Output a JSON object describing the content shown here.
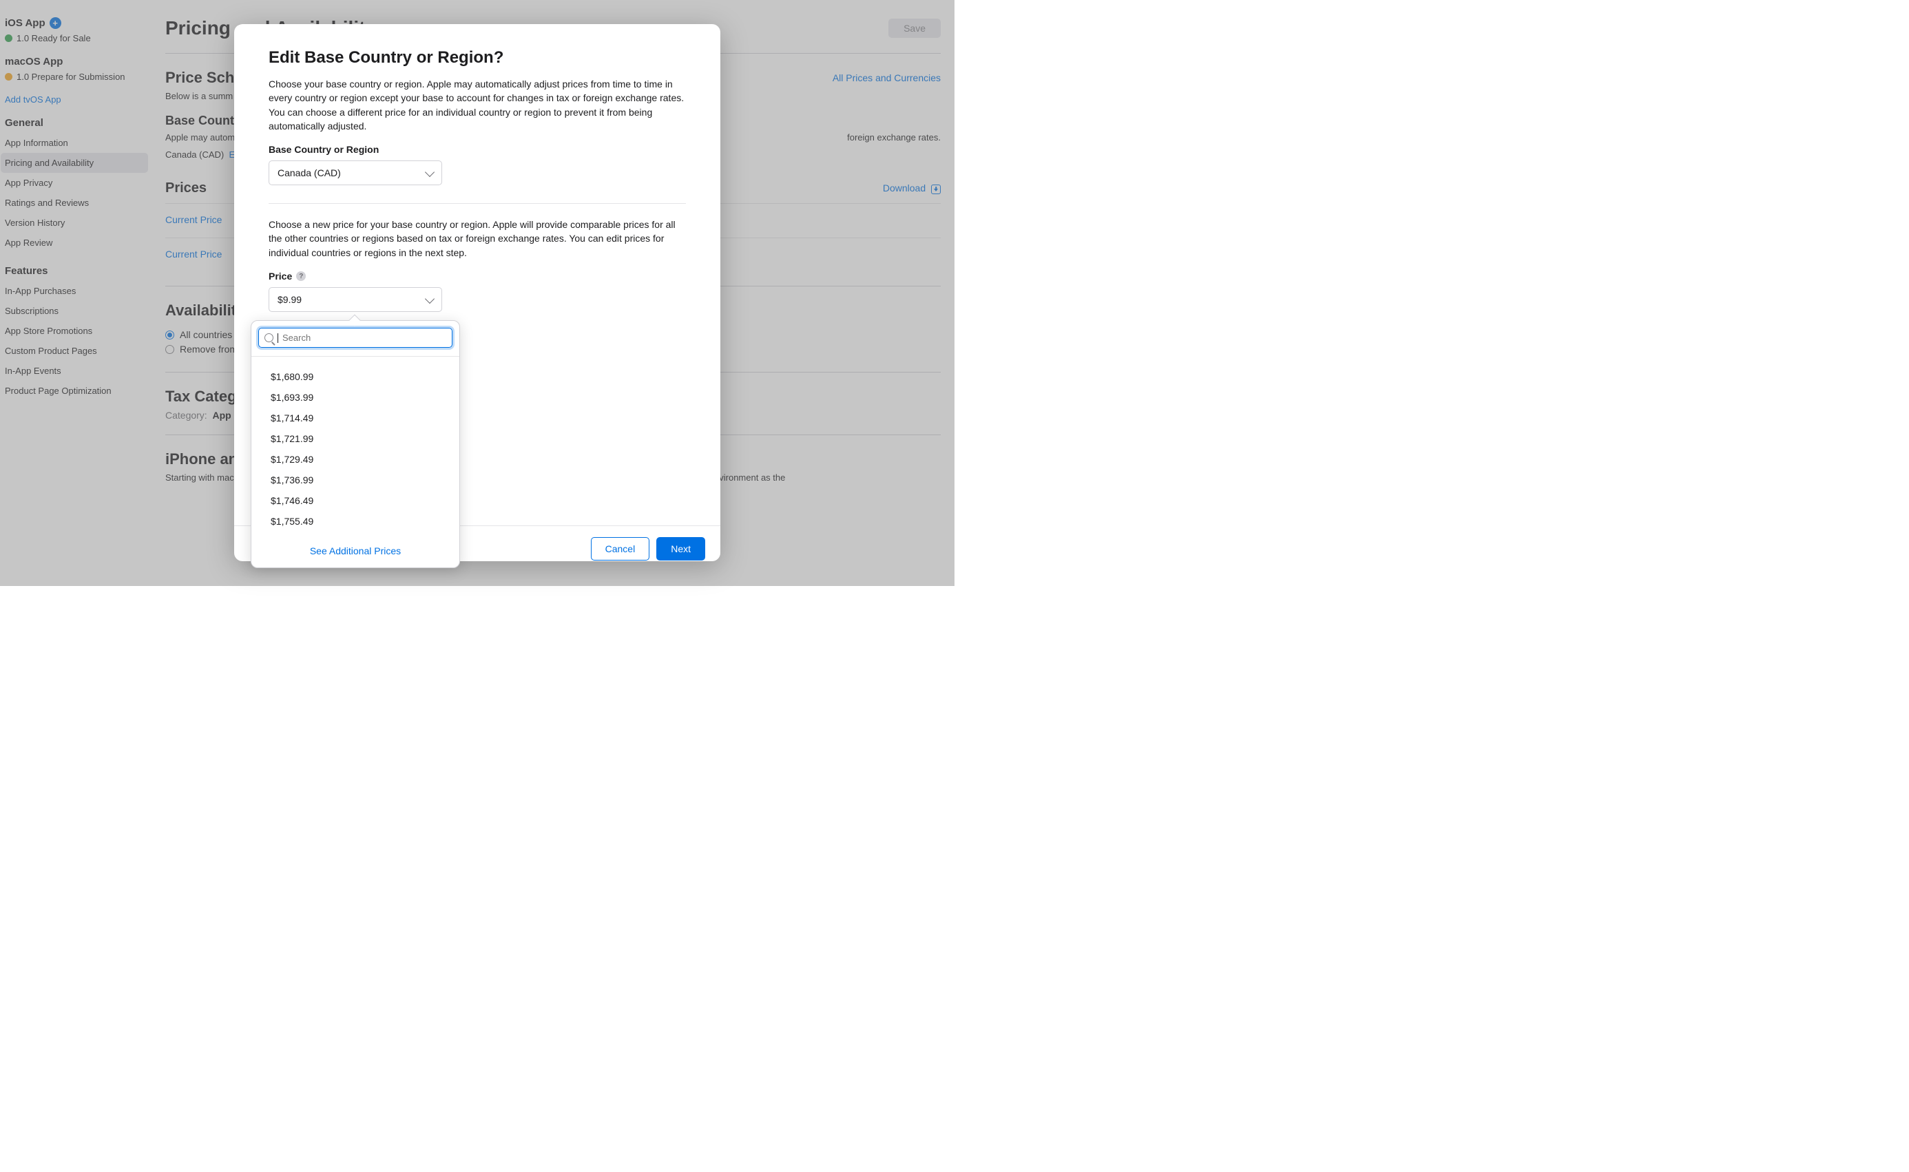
{
  "sidebar": {
    "platforms": [
      {
        "title": "iOS App",
        "status": "1.0 Ready for Sale",
        "dot": "green",
        "has_add": true
      },
      {
        "title": "macOS App",
        "status": "1.0 Prepare for Submission",
        "dot": "yellow",
        "has_add": false
      }
    ],
    "add_tvos": "Add tvOS App",
    "general_title": "General",
    "general_items": [
      "App Information",
      "Pricing and Availability",
      "App Privacy",
      "Ratings and Reviews",
      "Version History",
      "App Review"
    ],
    "active_index": 1,
    "features_title": "Features",
    "features_items": [
      "In-App Purchases",
      "Subscriptions",
      "App Store Promotions",
      "Custom Product Pages",
      "In-App Events",
      "Product Page Optimization"
    ]
  },
  "page": {
    "title": "Pricing and Availability",
    "save": "Save",
    "schedule_title": "Price Schedule",
    "schedule_desc": "Below is a summ",
    "schedule_link": "All Prices and Currencies",
    "base_title": "Base Country or Region",
    "base_desc_a": "Apple may autom",
    "base_desc_b": "foreign exchange rates.",
    "base_value": "Canada (CAD)",
    "base_edit": "E",
    "prices_title": "Prices",
    "download": "Download",
    "current_price": "Current Price",
    "availability_title": "Availability",
    "avail_opt1": "All countries",
    "avail_opt2": "Remove from",
    "tax_title": "Tax Category",
    "tax_label": "Category:",
    "tax_value": "App S",
    "iphone_title": "iPhone and",
    "iphone_desc_a": "Starting with macO",
    "iphone_desc_b": "e made available on Apple silicon Macs. Apps will run natively and use the same frameworks, resources, and runtime environment as the"
  },
  "modal": {
    "title": "Edit Base Country or Region?",
    "para1": "Choose your base country or region. Apple may automatically adjust prices from time to time in every country or region except your base to account for changes in tax or foreign exchange rates. You can choose a different price for an individual country or region to prevent it from being automatically adjusted.",
    "base_label": "Base Country or Region",
    "base_value": "Canada (CAD)",
    "para2": "Choose a new price for your base country or region. Apple will provide comparable prices for all the other countries or regions based on tax or foreign exchange rates. You can edit prices for individual countries or regions in the next step.",
    "price_label": "Price",
    "price_value": "$9.99",
    "search_placeholder": "Search",
    "options": [
      "$1,680.99",
      "$1,693.99",
      "$1,714.49",
      "$1,721.99",
      "$1,729.49",
      "$1,736.99",
      "$1,746.49",
      "$1,755.49"
    ],
    "see_more": "See Additional Prices",
    "cancel": "Cancel",
    "next": "Next"
  }
}
